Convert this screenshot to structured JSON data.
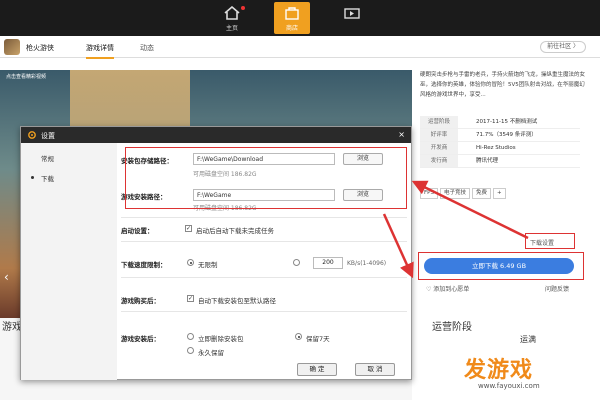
{
  "nav": {
    "home_label": "主页",
    "store_label": "商店"
  },
  "game": {
    "title": "枪火游侠",
    "tabs": {
      "detail": "游戏详情",
      "news": "动态"
    },
    "community_btn": "前往社区 〉"
  },
  "hero": {
    "badge": "点击查看精彩视频",
    "bottom_text": "游戏"
  },
  "info": {
    "description": "硬朗突击步枪与手雷的老兵，手持火箭炮的飞龙，操纵重生魔法的女巫，选择你的英雄，体验你的冒险！5V5团队射击对战，在华丽魔幻风格的游戏世界中，享受...",
    "rows": [
      {
        "k": "运营阶段",
        "v": "2017-11-15 不删档测试"
      },
      {
        "k": "好评率",
        "v": "71.7%（3549 条评测）"
      },
      {
        "k": "开发商",
        "v": "Hi-Rez Studios"
      },
      {
        "k": "发行商",
        "v": "腾讯代理"
      }
    ],
    "tags": [
      "FPS",
      "电子竞技",
      "免费",
      "+"
    ],
    "download_settings": "下载设置",
    "download_btn": "立即下载 6.49 GB",
    "wishlist": "添加到心愿单",
    "feedback": "问题反馈",
    "ops_title": "运营阶段",
    "ops_sub": "运满"
  },
  "dialog": {
    "title": "设置",
    "close": "×",
    "sidebar": {
      "general": "常规",
      "download": "下载"
    },
    "pkg_path_label": "安装包存储路径：",
    "pkg_path_value": "F:\\WeGame\\Download",
    "pkg_avail": "可用磁盘空间 186.82G",
    "install_path_label": "游戏安装路径：",
    "install_path_value": "F:\\WeGame",
    "install_avail": "可用磁盘空间 186.82G",
    "browse": "浏览",
    "startup_label": "启动设置：",
    "startup_opt": "启动后自动下载未完成任务",
    "speed_label": "下载速度限制：",
    "speed_unlimited": "无限制",
    "speed_value": "200",
    "speed_unit": "KB/s(1-4096)",
    "after_buy_label": "游戏购买后：",
    "after_buy_opt": "自动下载安装包至默认路径",
    "after_install_label": "游戏安装后：",
    "delete_now": "立即删除安装包",
    "keep_7": "保留7天",
    "keep_forever": "永久保留",
    "ok": "确 定",
    "cancel": "取 消"
  },
  "watermark": {
    "main": "发游戏",
    "url": "www.fayouxi.com"
  }
}
